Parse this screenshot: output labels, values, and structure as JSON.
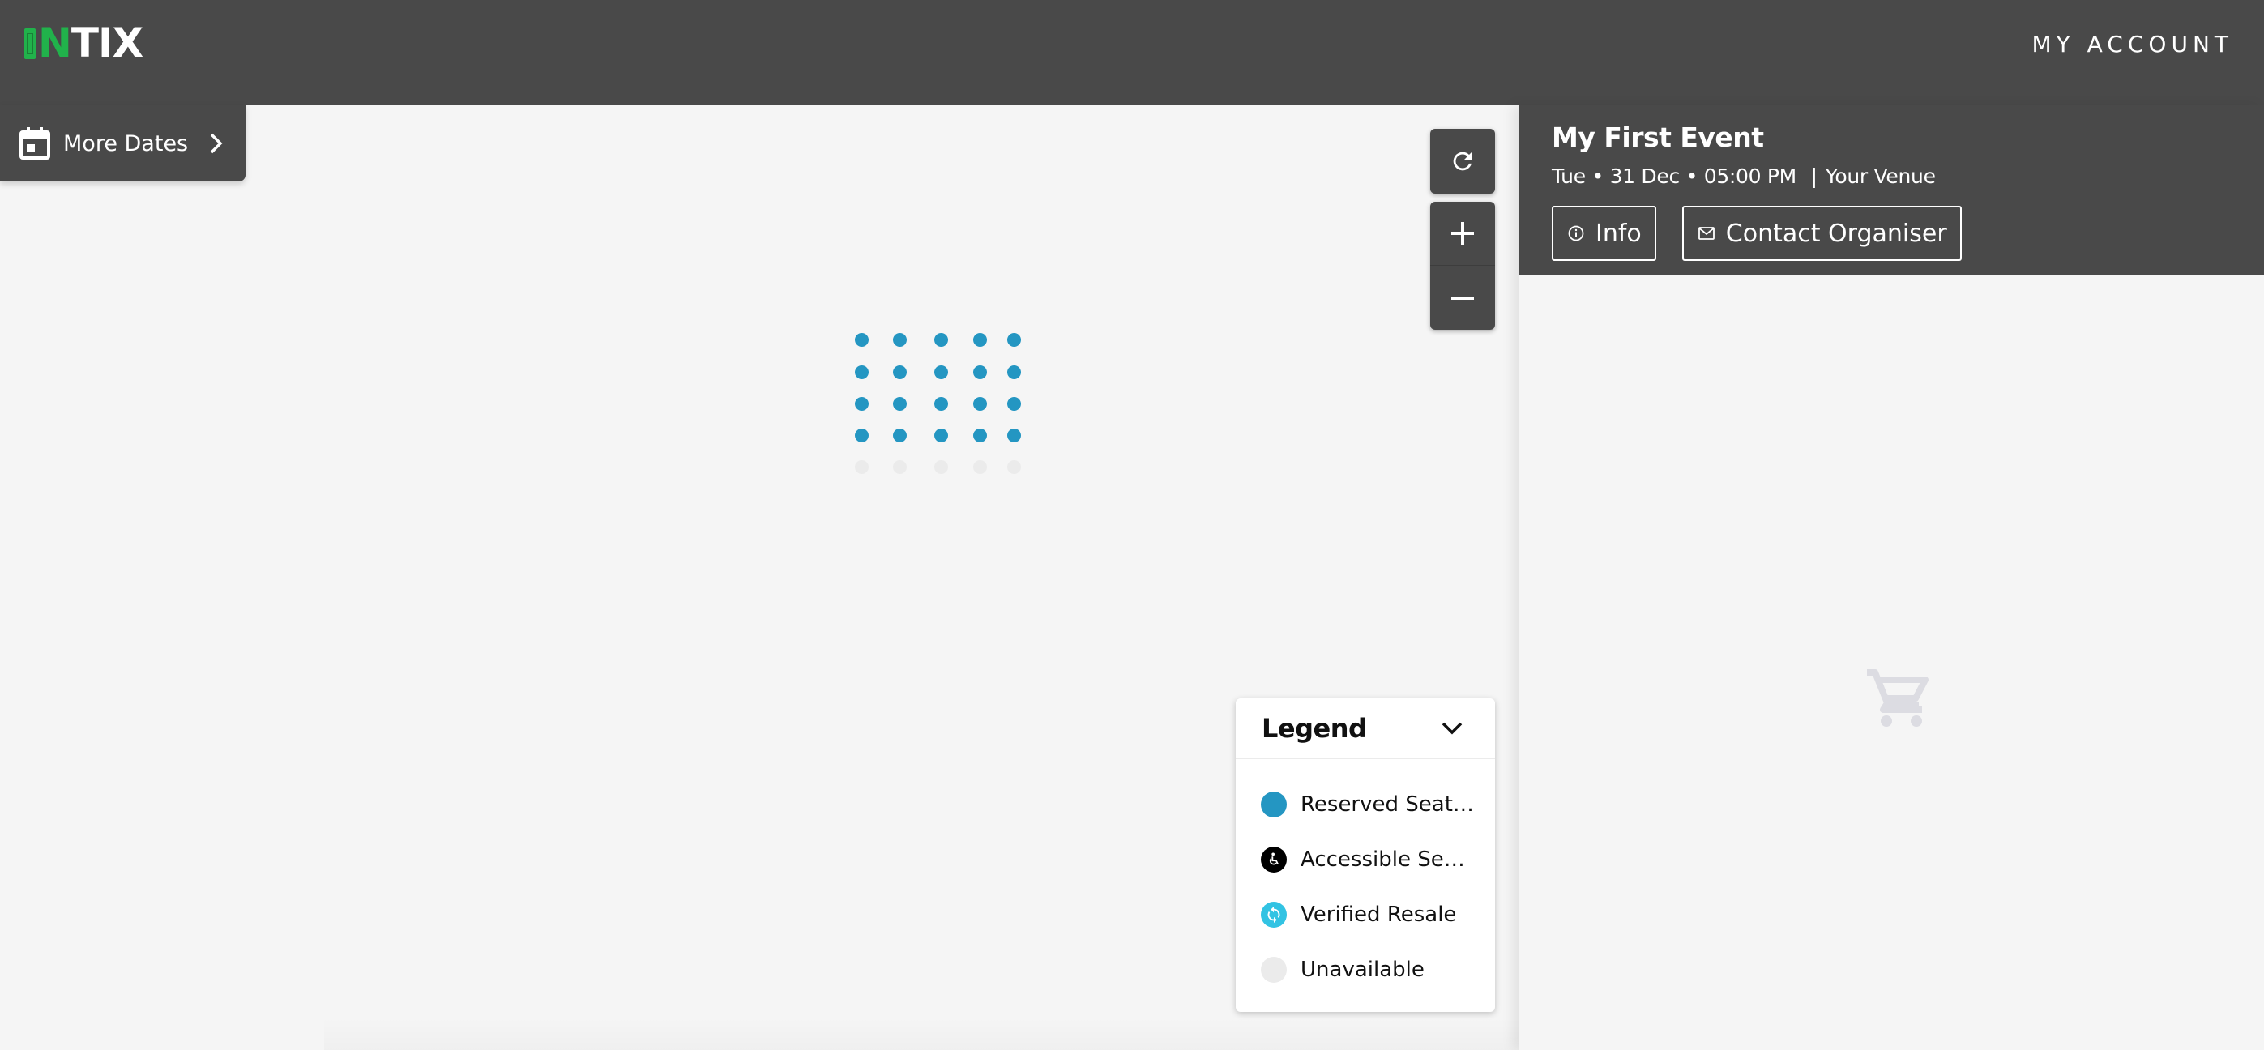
{
  "topbar": {
    "logo": {
      "first": "I",
      "accent": "N",
      "rest": "TIX",
      "accent_color": "#21b24b"
    },
    "account_label": "MY ACCOUNT"
  },
  "more_dates": {
    "label": "More Dates",
    "icon": "calendar-icon",
    "chevron": "chevron-right-icon"
  },
  "map": {
    "loader": {
      "columns": 5,
      "rows": 5,
      "active_rows": 4,
      "active_color": "#2496c2",
      "inactive_color": "#ebebeb"
    },
    "controls": {
      "refresh": "refresh-icon",
      "zoom_in": "plus-icon",
      "zoom_out": "minus-icon"
    }
  },
  "legend": {
    "title": "Legend",
    "toggle_icon": "chevron-down-icon",
    "items": [
      {
        "label": "Reserved Seating",
        "icon": "reserved-dot",
        "color": "#2496c2"
      },
      {
        "label": "Accessible Seating",
        "icon": "wheelchair-icon",
        "color": "#000000"
      },
      {
        "label": "Verified Resale",
        "icon": "resale-icon",
        "color": "#32c3e3"
      },
      {
        "label": "Unavailable",
        "icon": "unavailable-dot",
        "color": "#ebebeb"
      }
    ]
  },
  "event": {
    "title": "My First Event",
    "day": "Tue",
    "date": "31 Dec",
    "time": "05:00 PM",
    "bullet": "•",
    "divider": "|",
    "venue": "Your Venue",
    "buttons": [
      {
        "label": "Info",
        "icon": "info-icon"
      },
      {
        "label": "Contact Organiser",
        "icon": "mail-icon"
      }
    ]
  },
  "cart": {
    "icon": "cart-icon",
    "color": "#dcdce2"
  }
}
